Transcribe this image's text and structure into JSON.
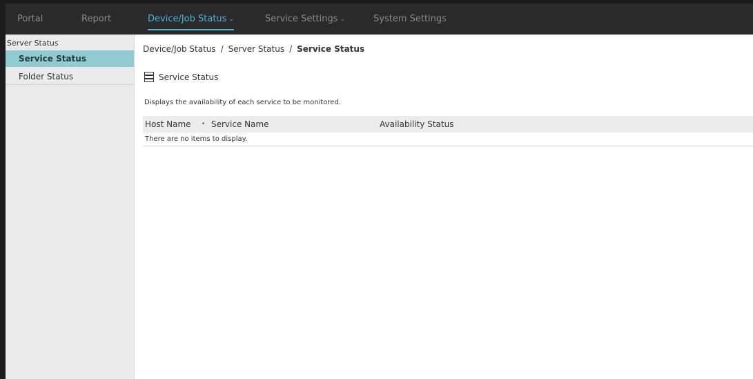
{
  "topnav": {
    "items": [
      {
        "label": "Portal",
        "active": false,
        "dropdown": false
      },
      {
        "label": "Report",
        "active": false,
        "dropdown": false
      },
      {
        "label": "Device/Job Status",
        "active": true,
        "dropdown": true
      },
      {
        "label": "Service Settings",
        "active": false,
        "dropdown": true
      },
      {
        "label": "System Settings",
        "active": false,
        "dropdown": false
      }
    ],
    "chevron": "⌄"
  },
  "sidebar": {
    "group_label": "Server Status",
    "items": [
      {
        "label": "Service Status",
        "selected": true
      },
      {
        "label": "Folder Status",
        "selected": false
      }
    ]
  },
  "breadcrumb": {
    "parts": [
      "Device/Job Status",
      "Server Status"
    ],
    "separator": "/",
    "current": "Service Status"
  },
  "section": {
    "icon": "server-icon",
    "title": "Service Status",
    "description": "Displays the availability of each service to be monitored."
  },
  "table": {
    "columns": [
      "Host Name",
      "Service Name",
      "Availability Status"
    ],
    "sort_marker": "•",
    "empty_message": "There are no items to display."
  },
  "colors": {
    "nav_background": "#2a2a2a",
    "nav_active": "#4fb3d9",
    "sidebar_selected": "#8fcbd0"
  }
}
